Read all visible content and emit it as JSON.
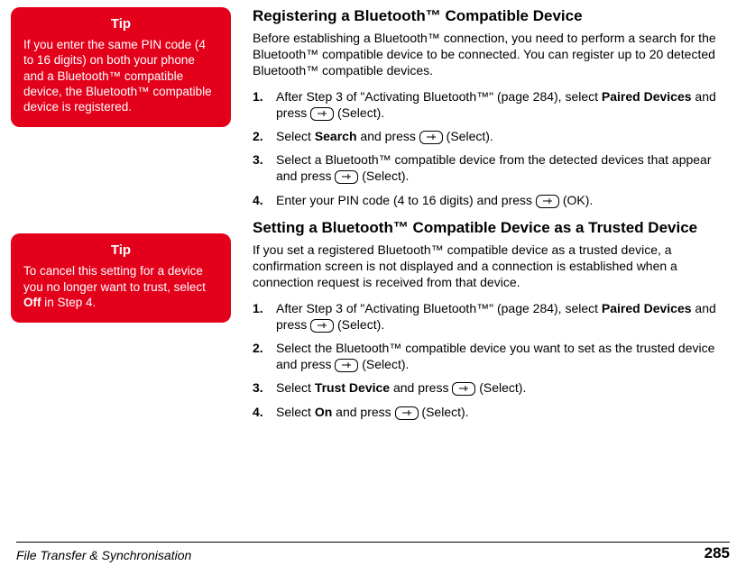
{
  "tip1": {
    "header": "Tip",
    "body_before": "If you enter the same PIN code (4 to 16 digits) on both your phone and a Bluetooth™ compatible device, the Bluetooth™ compatible device is registered."
  },
  "tip2": {
    "header": "Tip",
    "body_before": "To cancel this setting for a device you no longer want to trust, select ",
    "body_bold": "Off",
    "body_after": " in Step 4."
  },
  "section1": {
    "heading": "Registering a Bluetooth™ Compatible Device",
    "intro": "Before establishing a Bluetooth™ connection, you need to perform a search for the Bluetooth™ compatible device to be connected. You can register up to 20 detected Bluetooth™ compatible devices.",
    "steps": [
      {
        "a": "After Step 3 of \"Activating Bluetooth™\" (page 284), select ",
        "b": "Paired Devices",
        "c": " and press ",
        "btn": "(Select)."
      },
      {
        "a": "Select ",
        "b": "Search",
        "c": " and press ",
        "btn": "(Select)."
      },
      {
        "a": "Select a Bluetooth™ compatible device from the detected devices that appear and press ",
        "b": "",
        "c": "",
        "btn": "(Select)."
      },
      {
        "a": "Enter your PIN code (4 to 16 digits) and press ",
        "b": "",
        "c": "",
        "btn": "(OK)."
      }
    ]
  },
  "section2": {
    "heading": "Setting a Bluetooth™ Compatible Device as a Trusted Device",
    "intro": "If you set a registered Bluetooth™ compatible device as a trusted device, a confirmation screen is not displayed and a connection is established when a connection request is received from that device.",
    "steps": [
      {
        "a": "After Step 3 of \"Activating Bluetooth™\" (page 284), select ",
        "b": "Paired Devices",
        "c": " and press ",
        "btn": "(Select)."
      },
      {
        "a": "Select the Bluetooth™ compatible device you want to set as the trusted device and press ",
        "b": "",
        "c": "",
        "btn": "(Select)."
      },
      {
        "a": "Select ",
        "b": "Trust Device",
        "c": " and press ",
        "btn": "(Select)."
      },
      {
        "a": "Select ",
        "b": "On",
        "c": " and press ",
        "btn": "(Select)."
      }
    ]
  },
  "footer": {
    "left": "File Transfer & Synchronisation",
    "right": "285"
  }
}
